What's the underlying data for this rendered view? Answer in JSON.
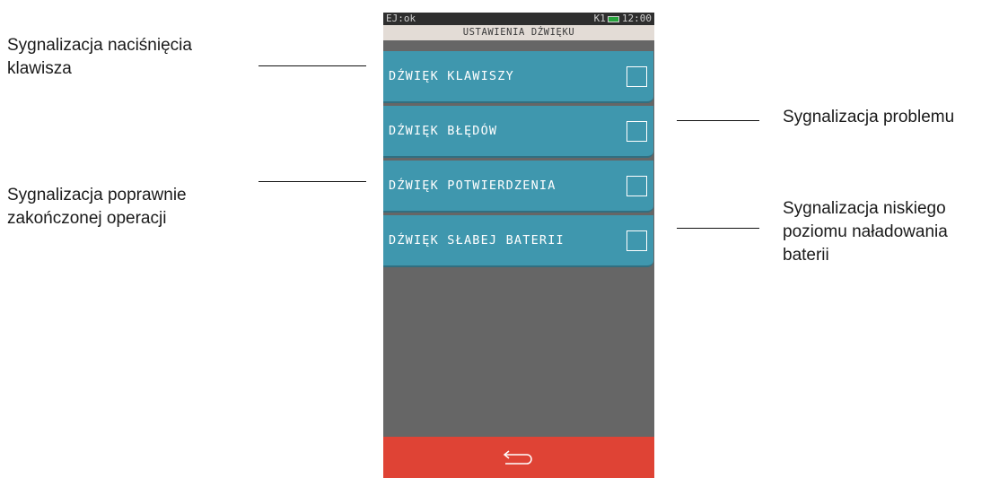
{
  "callouts": {
    "key_press": "Sygnalizacja naciśnięcia\nklawisza",
    "problem": "Sygnalizacja problemu",
    "success": "Sygnalizacja poprawnie\nzakończonej operacji",
    "low_battery": "Sygnalizacja niskiego\npoziomu naładowania\nbaterii"
  },
  "status_bar": {
    "left": "EJ:ok",
    "indicator": "K1",
    "time": "12:00",
    "battery_color": "#27a33d"
  },
  "screen": {
    "title": "USTAWIENIA DŹWIĘKU",
    "items": [
      {
        "label": "DŹWIĘK KLAWISZY",
        "checked": false
      },
      {
        "label": "DŹWIĘK BŁĘDÓW",
        "checked": false
      },
      {
        "label": "DŹWIĘK POTWIERDZENIA",
        "checked": false
      },
      {
        "label": "DŹWIĘK SŁABEJ BATERII",
        "checked": false
      }
    ]
  },
  "bottom_bar": {
    "icon": "back-arrow-icon"
  },
  "colors": {
    "row": "#3f97ae",
    "background": "#666666",
    "title_bar": "#e3dcd6",
    "bottom_bar": "#df4335"
  }
}
